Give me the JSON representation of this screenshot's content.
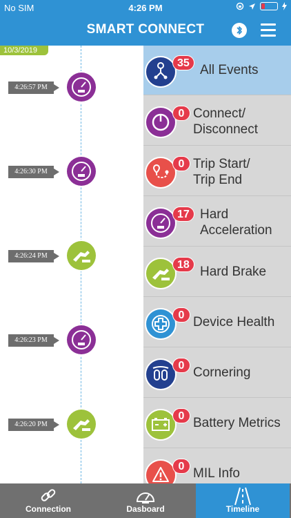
{
  "status_bar": {
    "carrier": "No SIM",
    "time": "4:26 PM"
  },
  "header": {
    "title": "SMART CONNECT",
    "bluetooth_icon": "bluetooth-icon",
    "menu_icon": "hamburger-menu-icon"
  },
  "timeline": {
    "date": "10/3/2019",
    "entries": [
      {
        "time": "4:26:57 PM",
        "icon": "speedometer-icon",
        "color": "#8b2f96"
      },
      {
        "time": "4:26:30 PM",
        "icon": "speedometer-icon",
        "color": "#8b2f96"
      },
      {
        "time": "4:26:24 PM",
        "icon": "brake-pedal-icon",
        "color": "#9dc23b"
      },
      {
        "time": "4:26:23 PM",
        "icon": "speedometer-icon",
        "color": "#8b2f96"
      },
      {
        "time": "4:26:20 PM",
        "icon": "brake-pedal-icon",
        "color": "#9dc23b"
      }
    ]
  },
  "events": [
    {
      "label_1": "All Events",
      "label_2": "",
      "count": "35",
      "icon": "route-nodes-icon",
      "color": "#23408f"
    },
    {
      "label_1": "Connect/",
      "label_2": "Disconnect",
      "count": "0",
      "icon": "power-icon",
      "color": "#8b2f96"
    },
    {
      "label_1": "Trip Start/",
      "label_2": "Trip End",
      "count": "0",
      "icon": "route-pin-icon",
      "color": "#e8504a"
    },
    {
      "label_1": "Hard",
      "label_2": "Acceleration",
      "count": "17",
      "icon": "speedometer-icon",
      "color": "#8b2f96"
    },
    {
      "label_1": "Hard Brake",
      "label_2": "",
      "count": "18",
      "icon": "brake-pedal-icon",
      "color": "#9dc23b"
    },
    {
      "label_1": "Device Health",
      "label_2": "",
      "count": "0",
      "icon": "medical-cross-icon",
      "color": "#2f92d4"
    },
    {
      "label_1": "Cornering",
      "label_2": "",
      "count": "0",
      "icon": "cornering-icon",
      "color": "#23408f"
    },
    {
      "label_1": "Battery Metrics",
      "label_2": "",
      "count": "0",
      "icon": "battery-icon",
      "color": "#9dc23b"
    },
    {
      "label_1": "MIL Info",
      "label_2": "",
      "count": "0",
      "icon": "warning-icon",
      "color": "#e8504a"
    }
  ],
  "tabs": [
    {
      "label": "Connection",
      "icon": "link-icon"
    },
    {
      "label": "Dasboard",
      "icon": "speedometer-icon"
    },
    {
      "label": "Timeline",
      "icon": "road-icon"
    }
  ]
}
